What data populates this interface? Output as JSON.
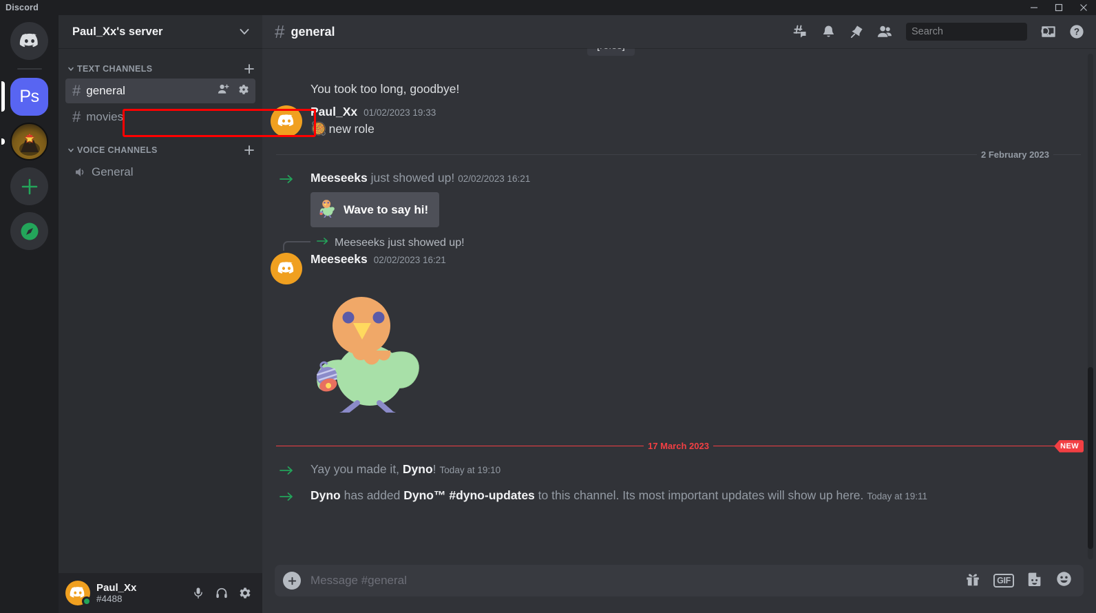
{
  "window": {
    "title": "Discord",
    "controls": {
      "minimize": "minimize-icon",
      "maximize": "maximize-icon",
      "close": "close-icon"
    }
  },
  "rail": {
    "items": [
      {
        "name": "home",
        "label": "",
        "icon": "discord-logo-icon",
        "state": "default"
      },
      {
        "name": "ps-server",
        "label": "Ps",
        "icon": "",
        "state": "active"
      },
      {
        "name": "star-server",
        "label": "",
        "icon": "star-server-icon",
        "state": "unread"
      },
      {
        "name": "add-server",
        "label": "",
        "icon": "plus-icon",
        "state": "default"
      },
      {
        "name": "explore-servers",
        "label": "",
        "icon": "compass-icon",
        "state": "default"
      }
    ]
  },
  "sidebar": {
    "server_name": "Paul_Xx's server",
    "categories": [
      {
        "label": "TEXT CHANNELS",
        "channels": [
          {
            "name": "general",
            "type": "text",
            "active": true,
            "highlighted": true
          },
          {
            "name": "movies",
            "type": "text",
            "active": false,
            "highlighted": false
          }
        ]
      },
      {
        "label": "VOICE CHANNELS",
        "channels": [
          {
            "name": "General",
            "type": "voice",
            "active": false,
            "highlighted": false
          }
        ]
      }
    ],
    "channel_actions": {
      "invite": "add-person-icon",
      "settings": "gear-icon"
    },
    "highlight_color": "#ff0000"
  },
  "user_panel": {
    "username": "Paul_Xx",
    "tag": "#4488",
    "status": "online",
    "status_color": "#23a55a",
    "buttons": [
      {
        "name": "mute-button",
        "icon": "microphone-icon"
      },
      {
        "name": "deafen-button",
        "icon": "headphones-icon"
      },
      {
        "name": "user-settings-button",
        "icon": "gear-icon"
      }
    ]
  },
  "channel_header": {
    "hash": "#",
    "title": "general",
    "tools": [
      {
        "name": "threads-button",
        "icon": "threads-icon"
      },
      {
        "name": "notifications-button",
        "icon": "bell-icon"
      },
      {
        "name": "pinned-messages-button",
        "icon": "pin-icon"
      },
      {
        "name": "member-list-button",
        "icon": "members-icon"
      }
    ],
    "right_tools": [
      {
        "name": "inbox-button",
        "icon": "inbox-icon"
      },
      {
        "name": "help-button",
        "icon": "help-icon"
      }
    ]
  },
  "search": {
    "placeholder": "Search",
    "value": "",
    "icon": "search-icon"
  },
  "messages": {
    "roles_chip": "[roles]",
    "top_line": "You took too long, goodbye!",
    "items": [
      {
        "kind": "user",
        "author": "Paul_Xx",
        "timestamp": "01/02/2023 19:33",
        "text": "new role",
        "emoji": "🥘"
      },
      {
        "kind": "divider",
        "label": "2 February 2023",
        "new": false
      },
      {
        "kind": "system",
        "author": "Meeseeks",
        "rest": " just showed up!",
        "timestamp": "02/02/2023 16:21",
        "button": "Wave to say hi!"
      },
      {
        "kind": "reply-ref",
        "text": "Meeseeks just showed up!"
      },
      {
        "kind": "user-sticker",
        "author": "Meeseeks",
        "timestamp": "02/02/2023 16:21",
        "sticker": "waving-bird-sticker"
      },
      {
        "kind": "divider",
        "label": "17 March 2023",
        "new": true,
        "new_badge": "NEW"
      },
      {
        "kind": "system-plain",
        "prefix": "Yay you made it, ",
        "bold": "Dyno",
        "suffix": "!",
        "timestamp": "Today at 19:10"
      },
      {
        "kind": "system-dyno",
        "b1": "Dyno",
        "t1": " has added ",
        "b2": "Dyno™ #dyno-updates",
        "t2": " to this channel. Its most important updates will show up here.",
        "timestamp": "Today at 19:11"
      }
    ]
  },
  "composer": {
    "placeholder": "Message #general",
    "value": "",
    "attach_icon": "plus-icon",
    "tools": [
      {
        "name": "gift-button",
        "icon": "gift-icon",
        "label": ""
      },
      {
        "name": "gif-button",
        "icon": "gif-icon",
        "label": "GIF"
      },
      {
        "name": "sticker-button",
        "icon": "sticker-icon",
        "label": ""
      },
      {
        "name": "emoji-button",
        "icon": "emoji-icon",
        "label": ""
      }
    ]
  },
  "colors": {
    "rail_bg": "#1e1f22",
    "sidebar_bg": "#2b2d31",
    "chat_bg": "#313338",
    "accent": "#5865f2",
    "green": "#23a55a",
    "red": "#f23f43"
  }
}
